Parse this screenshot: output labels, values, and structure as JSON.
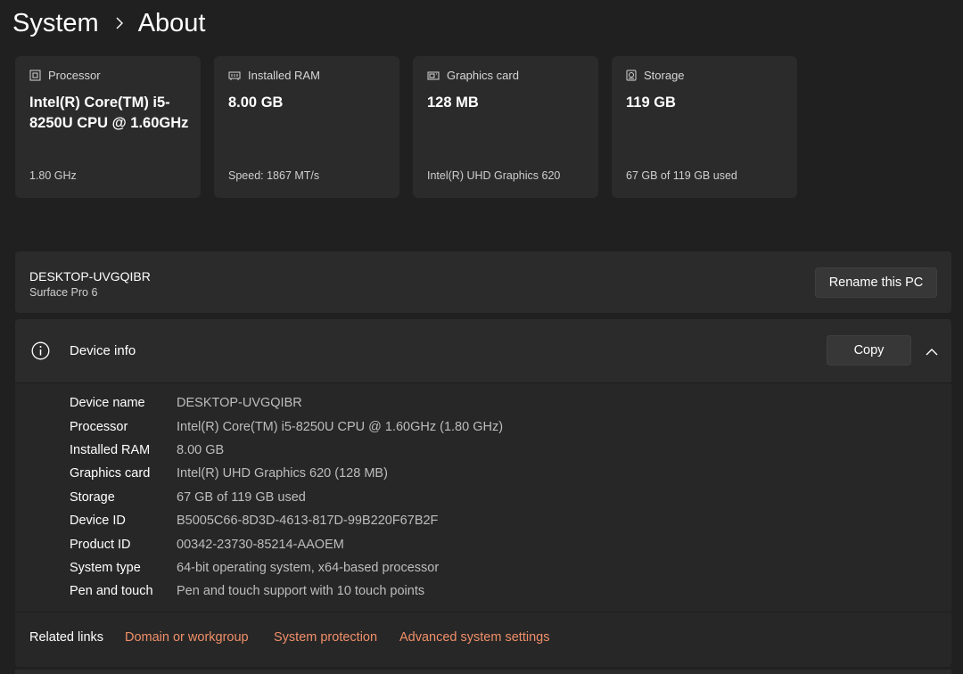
{
  "breadcrumb": {
    "parent": "System",
    "current": "About"
  },
  "spec_cards": [
    {
      "icon": "processor-icon",
      "label": "Processor",
      "value": "Intel(R) Core(TM) i5-8250U CPU @ 1.60GHz",
      "detail": "1.80 GHz"
    },
    {
      "icon": "ram-icon",
      "label": "Installed RAM",
      "value": "8.00 GB",
      "detail": "Speed: 1867 MT/s"
    },
    {
      "icon": "graphics-card-icon",
      "label": "Graphics card",
      "value": "128 MB",
      "detail": "Intel(R) UHD Graphics 620"
    },
    {
      "icon": "storage-icon",
      "label": "Storage",
      "value": "119 GB",
      "detail": "67 GB of 119 GB used"
    }
  ],
  "pc": {
    "name": "DESKTOP-UVGQIBR",
    "model": "Surface Pro 6",
    "rename_label": "Rename this PC"
  },
  "device_info": {
    "title": "Device info",
    "copy_label": "Copy",
    "rows": [
      {
        "label": "Device name",
        "value": "DESKTOP-UVGQIBR"
      },
      {
        "label": "Processor",
        "value": "Intel(R) Core(TM) i5-8250U CPU @ 1.60GHz (1.80 GHz)"
      },
      {
        "label": "Installed RAM",
        "value": "8.00 GB"
      },
      {
        "label": "Graphics card",
        "value": "Intel(R) UHD Graphics 620 (128 MB)"
      },
      {
        "label": "Storage",
        "value": "67 GB of 119 GB used"
      },
      {
        "label": "Device ID",
        "value": "B5005C66-8D3D-4613-817D-99B220F67B2F"
      },
      {
        "label": "Product ID",
        "value": "00342-23730-85214-AAOEM"
      },
      {
        "label": "System type",
        "value": "64-bit operating system, x64-based processor"
      },
      {
        "label": "Pen and touch",
        "value": "Pen and touch support with 10 touch points"
      }
    ]
  },
  "related_links": {
    "title": "Related links",
    "links": [
      "Domain or workgroup",
      "System protection",
      "Advanced system settings"
    ]
  },
  "colors": {
    "background": "#202020",
    "card": "#2b2b2b",
    "link_accent": "#f08f68"
  }
}
